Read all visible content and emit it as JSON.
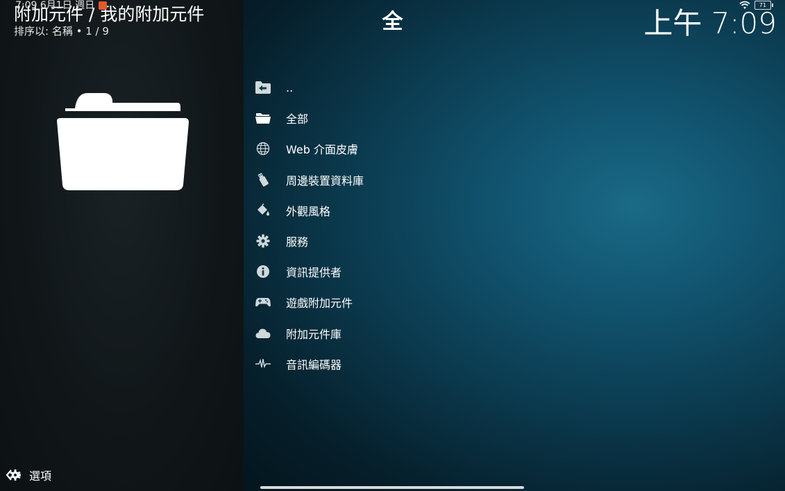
{
  "status_bar": {
    "time_date": "7:09 6月1日 週日",
    "battery": "71"
  },
  "header": {
    "breadcrumb": "附加元件 / 我的附加元件",
    "sort_info": "排序以: 名稱 • 1 / 9",
    "center_title": "全",
    "clock": "上午 7:09"
  },
  "menu": {
    "items": [
      {
        "label": "..",
        "icon": "back-folder-icon"
      },
      {
        "label": "全部",
        "icon": "folder-open-icon"
      },
      {
        "label": "Web 介面皮膚",
        "icon": "globe-icon"
      },
      {
        "label": "周邊裝置資料庫",
        "icon": "usb-icon"
      },
      {
        "label": "外觀風格",
        "icon": "paint-bucket-icon"
      },
      {
        "label": "服務",
        "icon": "gear-icon"
      },
      {
        "label": "資訊提供者",
        "icon": "info-icon"
      },
      {
        "label": "遊戲附加元件",
        "icon": "gamepad-icon"
      },
      {
        "label": "附加元件庫",
        "icon": "cloud-icon"
      },
      {
        "label": "音訊編碼器",
        "icon": "waveform-icon"
      }
    ]
  },
  "footer": {
    "options_label": "選項"
  }
}
